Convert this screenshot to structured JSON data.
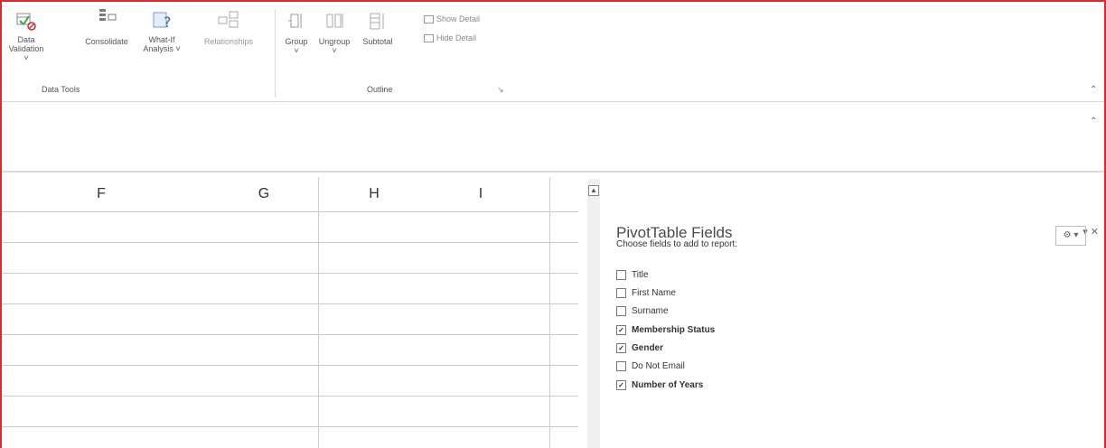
{
  "ribbon": {
    "data_validation": "Data\nValidation ˅",
    "consolidate": "Consolidate",
    "what_if": "What-If\nAnalysis ˅",
    "relationships": "Relationships",
    "group": "Group\n˅",
    "ungroup": "Ungroup\n˅",
    "subtotal": "Subtotal",
    "show_detail": "Show Detail",
    "hide_detail": "Hide Detail",
    "group_data_tools": "Data Tools",
    "group_outline": "Outline"
  },
  "grid": {
    "columns": [
      "F",
      "G",
      "H",
      "I"
    ]
  },
  "pivot": {
    "title": "PivotTable Fields",
    "subtitle": "Choose fields to add to report:",
    "fields": [
      {
        "label": "Title",
        "checked": false
      },
      {
        "label": "First Name",
        "checked": false
      },
      {
        "label": "Surname",
        "checked": false
      },
      {
        "label": "Membership Status",
        "checked": true
      },
      {
        "label": "Gender",
        "checked": true
      },
      {
        "label": "Do Not Email",
        "checked": false
      },
      {
        "label": "Number of Years",
        "checked": true
      }
    ]
  }
}
